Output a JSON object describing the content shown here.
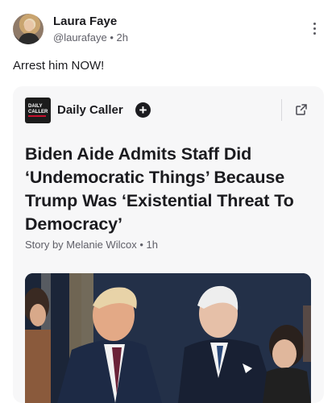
{
  "post": {
    "author_name": "Laura Faye",
    "author_handle": "@laurafaye",
    "separator": "•",
    "time_ago": "2h",
    "text": "Arrest him NOW!"
  },
  "card": {
    "source_logo_line1": "DAILY",
    "source_logo_line2": "CALLER",
    "source_name": "Daily Caller",
    "follow_icon_glyph": "+",
    "headline": "Biden Aide Admits Staff Did ‘Undemocratic Things’ Because Trump Was ‘Existential Threat To Democracy’",
    "byline": "Story by Melanie Wilcox • 1h"
  },
  "icons": {
    "more": "kebab-vertical-icon",
    "follow": "plus-circle-icon",
    "external": "external-link-icon"
  },
  "colors": {
    "text_primary": "#1b1b1f",
    "text_secondary": "#5f5f68",
    "card_background": "#f7f7f8",
    "logo_accent": "#c8102e"
  }
}
